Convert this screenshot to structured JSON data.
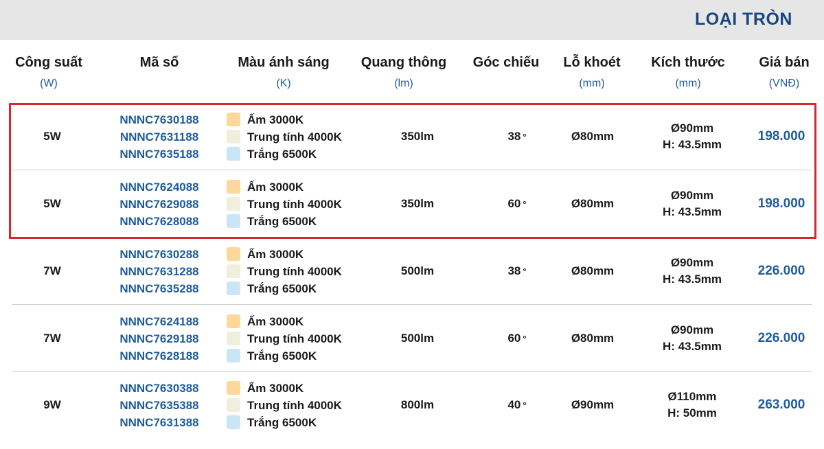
{
  "title": "LOẠI TRÒN",
  "headers": [
    {
      "label": "Công suất",
      "unit": "(W)"
    },
    {
      "label": "Mã số",
      "unit": ""
    },
    {
      "label": "Màu ánh sáng",
      "unit": "(K)"
    },
    {
      "label": "Quang thông",
      "unit": "(lm)"
    },
    {
      "label": "Góc chiếu",
      "unit": ""
    },
    {
      "label": "Lỗ khoét",
      "unit": "(mm)"
    },
    {
      "label": "Kích thước",
      "unit": "(mm)"
    },
    {
      "label": "Giá bán",
      "unit": "(VNĐ)"
    }
  ],
  "colors": {
    "accent": "#1f5c99",
    "title": "#16477f",
    "highlight": "#d7262d",
    "warm": "#fcd89a",
    "neutral": "#efefdc",
    "white": "#c9e6f7"
  },
  "rows": [
    {
      "power": "5W",
      "codes": [
        "NNNC7630188",
        "NNNC7631188",
        "NNNC7635188"
      ],
      "lights": [
        {
          "label": "Ấm 3000K",
          "swatch": "warm"
        },
        {
          "label": "Trung tính 4000K",
          "swatch": "neutral"
        },
        {
          "label": "Trắng 6500K",
          "swatch": "white"
        }
      ],
      "flux": "350lm",
      "angle": "38",
      "deg": "°",
      "hole": "Ø80mm",
      "size": [
        "Ø90mm",
        "H: 43.5mm"
      ],
      "price": "198.000"
    },
    {
      "power": "5W",
      "codes": [
        "NNNC7624088",
        "NNNC7629088",
        "NNNC7628088"
      ],
      "lights": [
        {
          "label": "Ấm 3000K",
          "swatch": "warm"
        },
        {
          "label": "Trung tính 4000K",
          "swatch": "neutral"
        },
        {
          "label": "Trắng 6500K",
          "swatch": "white"
        }
      ],
      "flux": "350lm",
      "angle": "60",
      "deg": "°",
      "hole": "Ø80mm",
      "size": [
        "Ø90mm",
        "H: 43.5mm"
      ],
      "price": "198.000"
    },
    {
      "power": "7W",
      "codes": [
        "NNNC7630288",
        "NNNC7631288",
        "NNNC7635288"
      ],
      "lights": [
        {
          "label": "Ấm 3000K",
          "swatch": "warm"
        },
        {
          "label": "Trung tính 4000K",
          "swatch": "neutral"
        },
        {
          "label": "Trắng 6500K",
          "swatch": "white"
        }
      ],
      "flux": "500lm",
      "angle": "38",
      "deg": "°",
      "hole": "Ø80mm",
      "size": [
        "Ø90mm",
        "H: 43.5mm"
      ],
      "price": "226.000"
    },
    {
      "power": "7W",
      "codes": [
        "NNNC7624188",
        "NNNC7629188",
        "NNNC7628188"
      ],
      "lights": [
        {
          "label": "Ấm 3000K",
          "swatch": "warm"
        },
        {
          "label": "Trung tính 4000K",
          "swatch": "neutral"
        },
        {
          "label": "Trắng 6500K",
          "swatch": "white"
        }
      ],
      "flux": "500lm",
      "angle": "60",
      "deg": "°",
      "hole": "Ø80mm",
      "size": [
        "Ø90mm",
        "H: 43.5mm"
      ],
      "price": "226.000"
    },
    {
      "power": "9W",
      "codes": [
        "NNNC7630388",
        "NNNC7635388",
        "NNNC7631388"
      ],
      "lights": [
        {
          "label": "Ấm 3000K",
          "swatch": "warm"
        },
        {
          "label": "Trung tính 4000K",
          "swatch": "neutral"
        },
        {
          "label": "Trắng 6500K",
          "swatch": "white"
        }
      ],
      "flux": "800lm",
      "angle": "40",
      "deg": "°",
      "hole": "Ø90mm",
      "size": [
        "Ø110mm",
        "H: 50mm"
      ],
      "price": "263.000"
    }
  ]
}
